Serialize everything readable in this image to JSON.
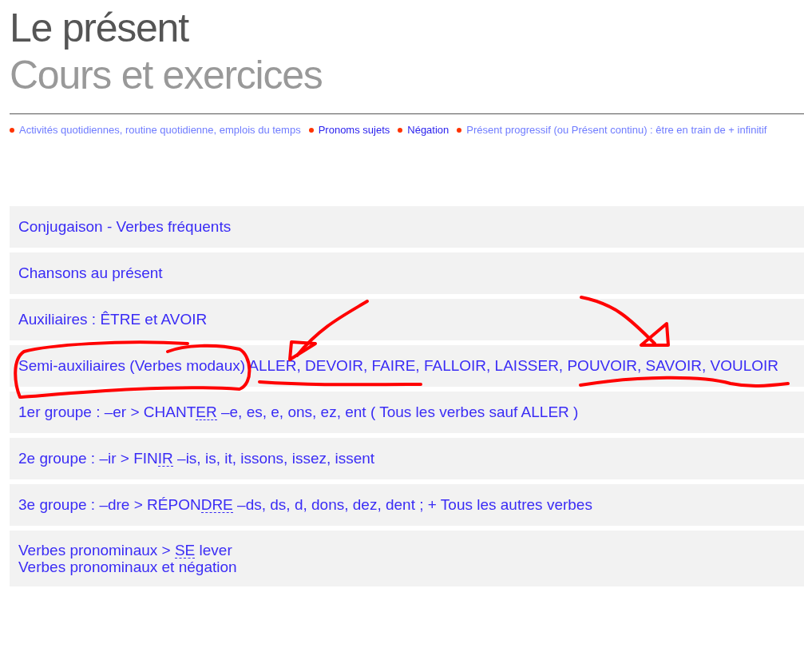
{
  "title": "Le présent",
  "subtitle": "Cours et exercices",
  "topics": [
    {
      "label": "Activités quotidiennes, routine quotidienne, emplois du temps",
      "visited": true
    },
    {
      "label": "Pronoms sujets",
      "visited": false
    },
    {
      "label": "Négation",
      "visited": false
    },
    {
      "label": "Présent progressif (ou Présent continu) : être en train de + infinitif",
      "visited": true
    }
  ],
  "rows": [
    {
      "lines": [
        [
          {
            "text": "Conjugaison - Verbes fréquents",
            "dotted": false
          }
        ]
      ]
    },
    {
      "lines": [
        [
          {
            "text": "Chansons au présent",
            "dotted": false
          }
        ]
      ]
    },
    {
      "lines": [
        [
          {
            "text": "Auxiliaires : ÊTRE et AVOIR",
            "dotted": false
          }
        ]
      ]
    },
    {
      "lines": [
        [
          {
            "text": "Semi-auxiliaires (Verbes modaux) ALLER, DEVOIR, FAIRE, FALLOIR, LAISSER, POUVOIR, SAVOIR, VOULOIR",
            "dotted": false
          }
        ]
      ]
    },
    {
      "lines": [
        [
          {
            "text": "1er groupe : –er > CHANT",
            "dotted": false
          },
          {
            "text": "ER",
            "dotted": true
          },
          {
            "text": " –e, es, e, ons, ez, ent ( Tous les verbes sauf ALLER )",
            "dotted": false
          }
        ]
      ]
    },
    {
      "lines": [
        [
          {
            "text": "2e groupe : –ir > FIN",
            "dotted": false
          },
          {
            "text": "IR",
            "dotted": true
          },
          {
            "text": " –is, is, it, issons, issez, issent",
            "dotted": false
          }
        ]
      ]
    },
    {
      "lines": [
        [
          {
            "text": "3e groupe : –dre > RÉPON",
            "dotted": false
          },
          {
            "text": "DRE",
            "dotted": true
          },
          {
            "text": " –ds, ds, d, dons, dez, dent ; + Tous les autres verbes",
            "dotted": false
          }
        ]
      ]
    },
    {
      "lines": [
        [
          {
            "text": "Verbes pronominaux > ",
            "dotted": false
          },
          {
            "text": "SE",
            "dotted": true
          },
          {
            "text": " lever",
            "dotted": false
          }
        ],
        [
          {
            "text": "Verbes pronominaux et négation",
            "dotted": false
          }
        ]
      ]
    }
  ]
}
